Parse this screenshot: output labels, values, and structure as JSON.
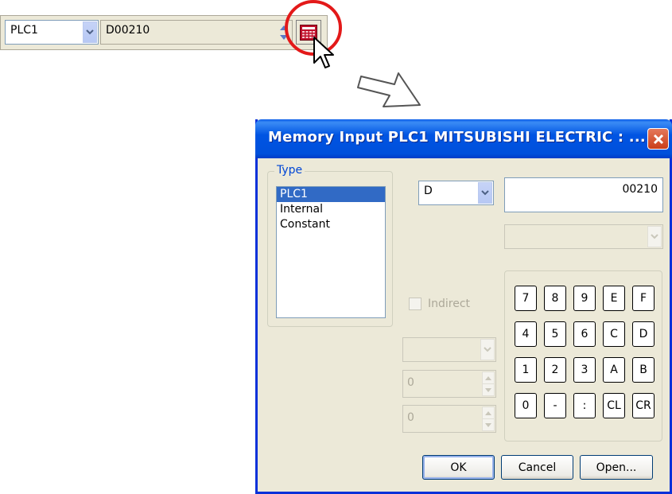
{
  "toolbar": {
    "device_value": "PLC1",
    "address_value": "D00210"
  },
  "dialog": {
    "title": "Memory Input  PLC1 MITSUBISHI ELECTRIC : ...",
    "type_group": {
      "legend": "Type",
      "items": [
        {
          "label": "PLC1",
          "selected": true
        },
        {
          "label": "Internal",
          "selected": false
        },
        {
          "label": "Constant",
          "selected": false
        }
      ]
    },
    "device_combo": "D",
    "address_input": "00210",
    "indirect_label": "Indirect",
    "spin1_value": "0",
    "spin2_value": "0",
    "keypad": [
      [
        "7",
        "8",
        "9",
        "E",
        "F"
      ],
      [
        "4",
        "5",
        "6",
        "C",
        "D"
      ],
      [
        "1",
        "2",
        "3",
        "A",
        "B"
      ],
      [
        "0",
        "-",
        ":",
        "CL",
        "CR"
      ]
    ],
    "buttons": {
      "ok": "OK",
      "cancel": "Cancel",
      "open": "Open..."
    }
  },
  "colors": {
    "titlebar": "#0054e3",
    "highlight_circle": "#e31919",
    "selection": "#316ac5"
  },
  "icons": [
    "chevron-down-icon",
    "calculator-icon",
    "cursor-icon",
    "arrow-icon",
    "close-icon"
  ]
}
